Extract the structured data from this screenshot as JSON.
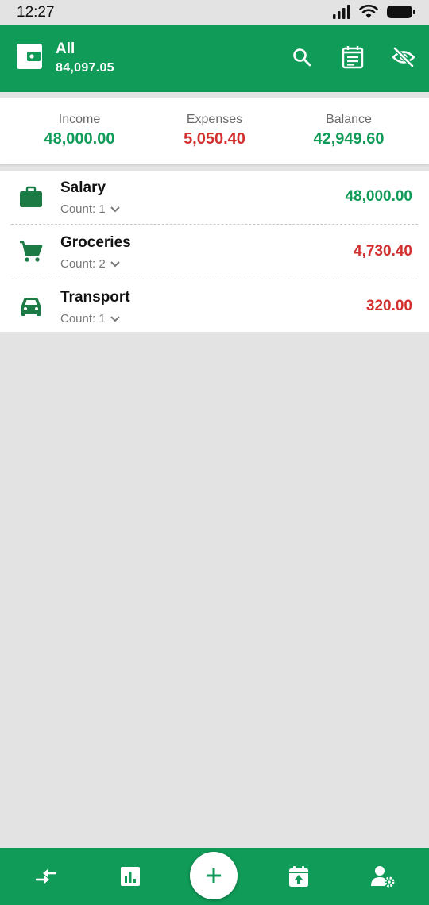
{
  "status_bar": {
    "time": "12:27"
  },
  "header": {
    "account_name": "All",
    "account_total": "84,097.05",
    "icons": [
      "wallet-icon",
      "search-icon",
      "calendar-note-icon",
      "eye-off-icon"
    ]
  },
  "summary": {
    "income_label": "Income",
    "income_value": "48,000.00",
    "expenses_label": "Expenses",
    "expenses_value": "5,050.40",
    "balance_label": "Balance",
    "balance_value": "42,949.60"
  },
  "categories": [
    {
      "name": "Salary",
      "count": "Count: 1",
      "amount": "48,000.00",
      "type": "income",
      "icon": "briefcase-icon"
    },
    {
      "name": "Groceries",
      "count": "Count: 2",
      "amount": "4,730.40",
      "type": "expense",
      "icon": "cart-icon"
    },
    {
      "name": "Transport",
      "count": "Count: 1",
      "amount": "320.00",
      "type": "expense",
      "icon": "car-icon"
    }
  ],
  "bottom_nav": {
    "icons": [
      "transfer-icon",
      "bar-chart-icon",
      "add-icon",
      "calendar-upload-icon",
      "account-settings-icon"
    ]
  },
  "colors": {
    "brand_green": "#109c58",
    "income_green": "#109c58",
    "expense_red": "#d32f2f",
    "background": "#e3e3e3"
  }
}
